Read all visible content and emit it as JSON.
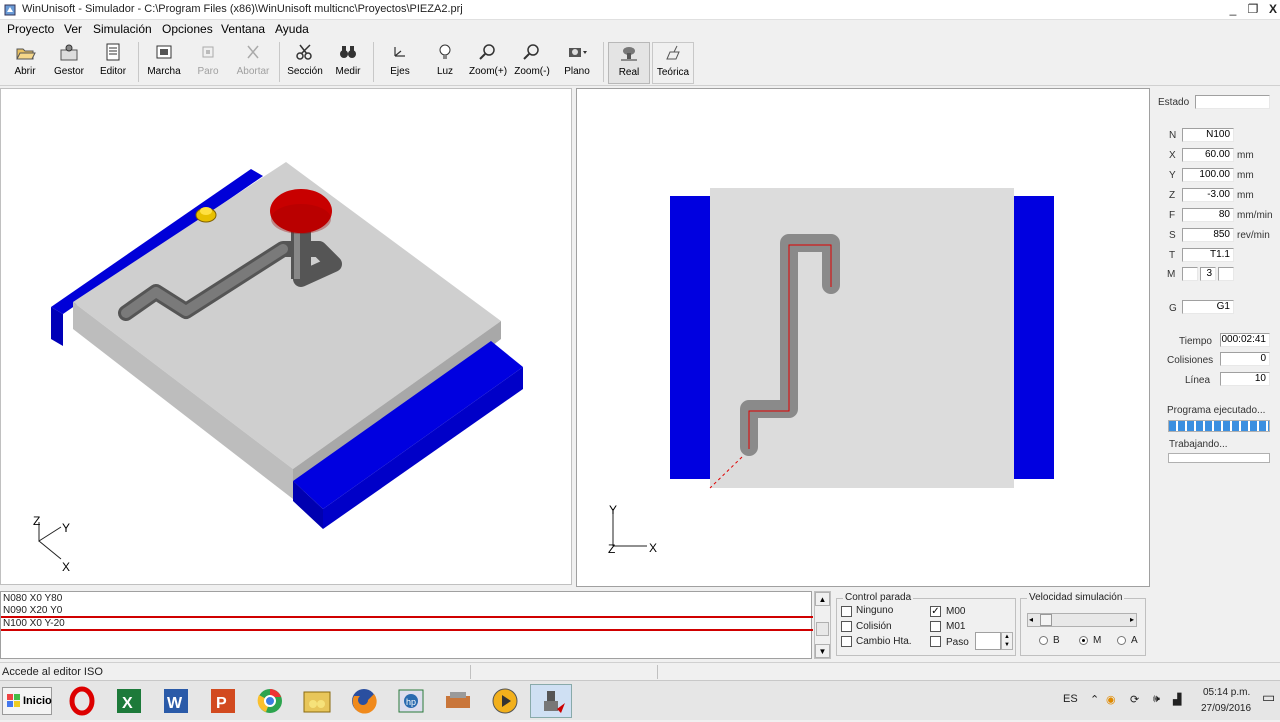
{
  "window": {
    "title": "WinUnisoft - Simulador - C:\\Program Files (x86)\\WinUnisoft multicnc\\Proyectos\\PIEZA2.prj",
    "controls": {
      "minimize": "_",
      "restore": "❐",
      "close": "X"
    }
  },
  "menu": [
    "Proyecto",
    "Ver",
    "Simulación",
    "Opciones",
    "Ventana",
    "Ayuda"
  ],
  "toolbar": {
    "abrir": "Abrir",
    "gestor": "Gestor",
    "editor": "Editor",
    "marcha": "Marcha",
    "paro": "Paro",
    "abortar": "Abortar",
    "seccion": "Sección",
    "medir": "Medir",
    "ejes": "Ejes",
    "luz": "Luz",
    "zoom_in": "Zoom(+)",
    "zoom_out": "Zoom(-)",
    "plano": "Plano",
    "real": "Real",
    "teorica": "Teórica"
  },
  "axes3d": {
    "z": "Z",
    "y": "Y",
    "x": "X"
  },
  "axes2d": {
    "y": "Y",
    "z": "Z",
    "x": "X"
  },
  "panel": {
    "estado_label": "Estado",
    "estado": "",
    "n_label": "N",
    "n": "N100",
    "x_label": "X",
    "x": "60.00",
    "x_unit": "mm",
    "y_label": "Y",
    "y": "100.00",
    "y_unit": "mm",
    "z_label": "Z",
    "z": "-3.00",
    "z_unit": "mm",
    "f_label": "F",
    "f": "80",
    "f_unit": "mm/min",
    "s_label": "S",
    "s": "850",
    "s_unit": "rev/min",
    "t_label": "T",
    "t": "T1.1",
    "m_label": "M",
    "m1": "",
    "m2": "3",
    "m3": "",
    "g_label": "G",
    "g": "G1",
    "tiempo_label": "Tiempo",
    "tiempo": "000:02:41",
    "colisiones_label": "Colisiones",
    "colisiones": "0",
    "linea_label": "Línea",
    "linea": "10",
    "programa_label": "Programa ejecutado...",
    "programa_progress": 1.0,
    "trabajando_label": "Trabajando...",
    "trabajando_progress": 0.0
  },
  "code": {
    "lines": [
      "N080 X0 Y80",
      "N090 X20 Y0",
      "N100 X0 Y-20"
    ]
  },
  "control_parada": {
    "title": "Control parada",
    "ninguno": "Ninguno",
    "ninguno_checked": false,
    "colision": "Colisión",
    "colision_checked": false,
    "cambio": "Cambio Hta.",
    "cambio_checked": false,
    "m00": "M00",
    "m00_checked": true,
    "m01": "M01",
    "m01_checked": false,
    "paso": "Paso",
    "paso_checked": false
  },
  "velocidad": {
    "title": "Velocidad simulación",
    "b": "B",
    "m": "M",
    "a": "A",
    "selected": "M"
  },
  "status": {
    "text": "Accede al editor ISO"
  },
  "taskbar": {
    "start": "Inicio",
    "lang": "ES",
    "time": "05:14 p.m.",
    "date": "27/09/2016"
  }
}
